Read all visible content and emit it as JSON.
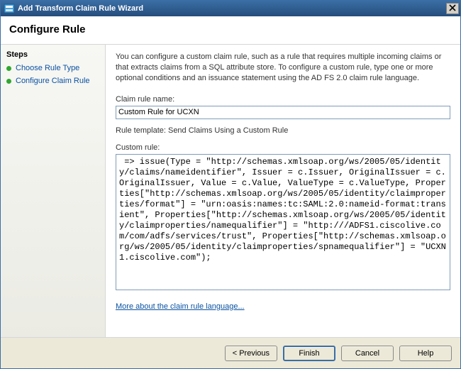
{
  "window": {
    "title": "Add Transform Claim Rule Wizard"
  },
  "header": {
    "title": "Configure Rule"
  },
  "sidebar": {
    "heading": "Steps",
    "items": [
      {
        "label": "Choose Rule Type"
      },
      {
        "label": "Configure Claim Rule"
      }
    ]
  },
  "main": {
    "intro": "You can configure a custom claim rule, such as a rule that requires multiple incoming claims or that extracts claims from a SQL attribute store. To configure a custom rule, type one or more optional conditions and an issuance statement using the AD FS 2.0 claim rule language.",
    "claim_rule_name_label": "Claim rule name:",
    "claim_rule_name_value": "Custom Rule for UCXN",
    "rule_template_label": "Rule template: Send Claims Using a Custom Rule",
    "custom_rule_label": "Custom rule:",
    "custom_rule_value": " => issue(Type = \"http://schemas.xmlsoap.org/ws/2005/05/identity/claims/nameidentifier\", Issuer = c.Issuer, OriginalIssuer = c.OriginalIssuer, Value = c.Value, ValueType = c.ValueType, Properties[\"http://schemas.xmlsoap.org/ws/2005/05/identity/claimproperties/format\"] = \"urn:oasis:names:tc:SAML:2.0:nameid-format:transient\", Properties[\"http://schemas.xmlsoap.org/ws/2005/05/identity/claimproperties/namequalifier\"] = \"http:///ADFS1.ciscolive.com/com/adfs/services/trust\", Properties[\"http://schemas.xmlsoap.org/ws/2005/05/identity/claimproperties/spnamequalifier\"] = \"UCXN1.ciscolive.com\");",
    "more_link": "More about the claim rule language..."
  },
  "footer": {
    "previous": "< Previous",
    "finish": "Finish",
    "cancel": "Cancel",
    "help": "Help"
  }
}
